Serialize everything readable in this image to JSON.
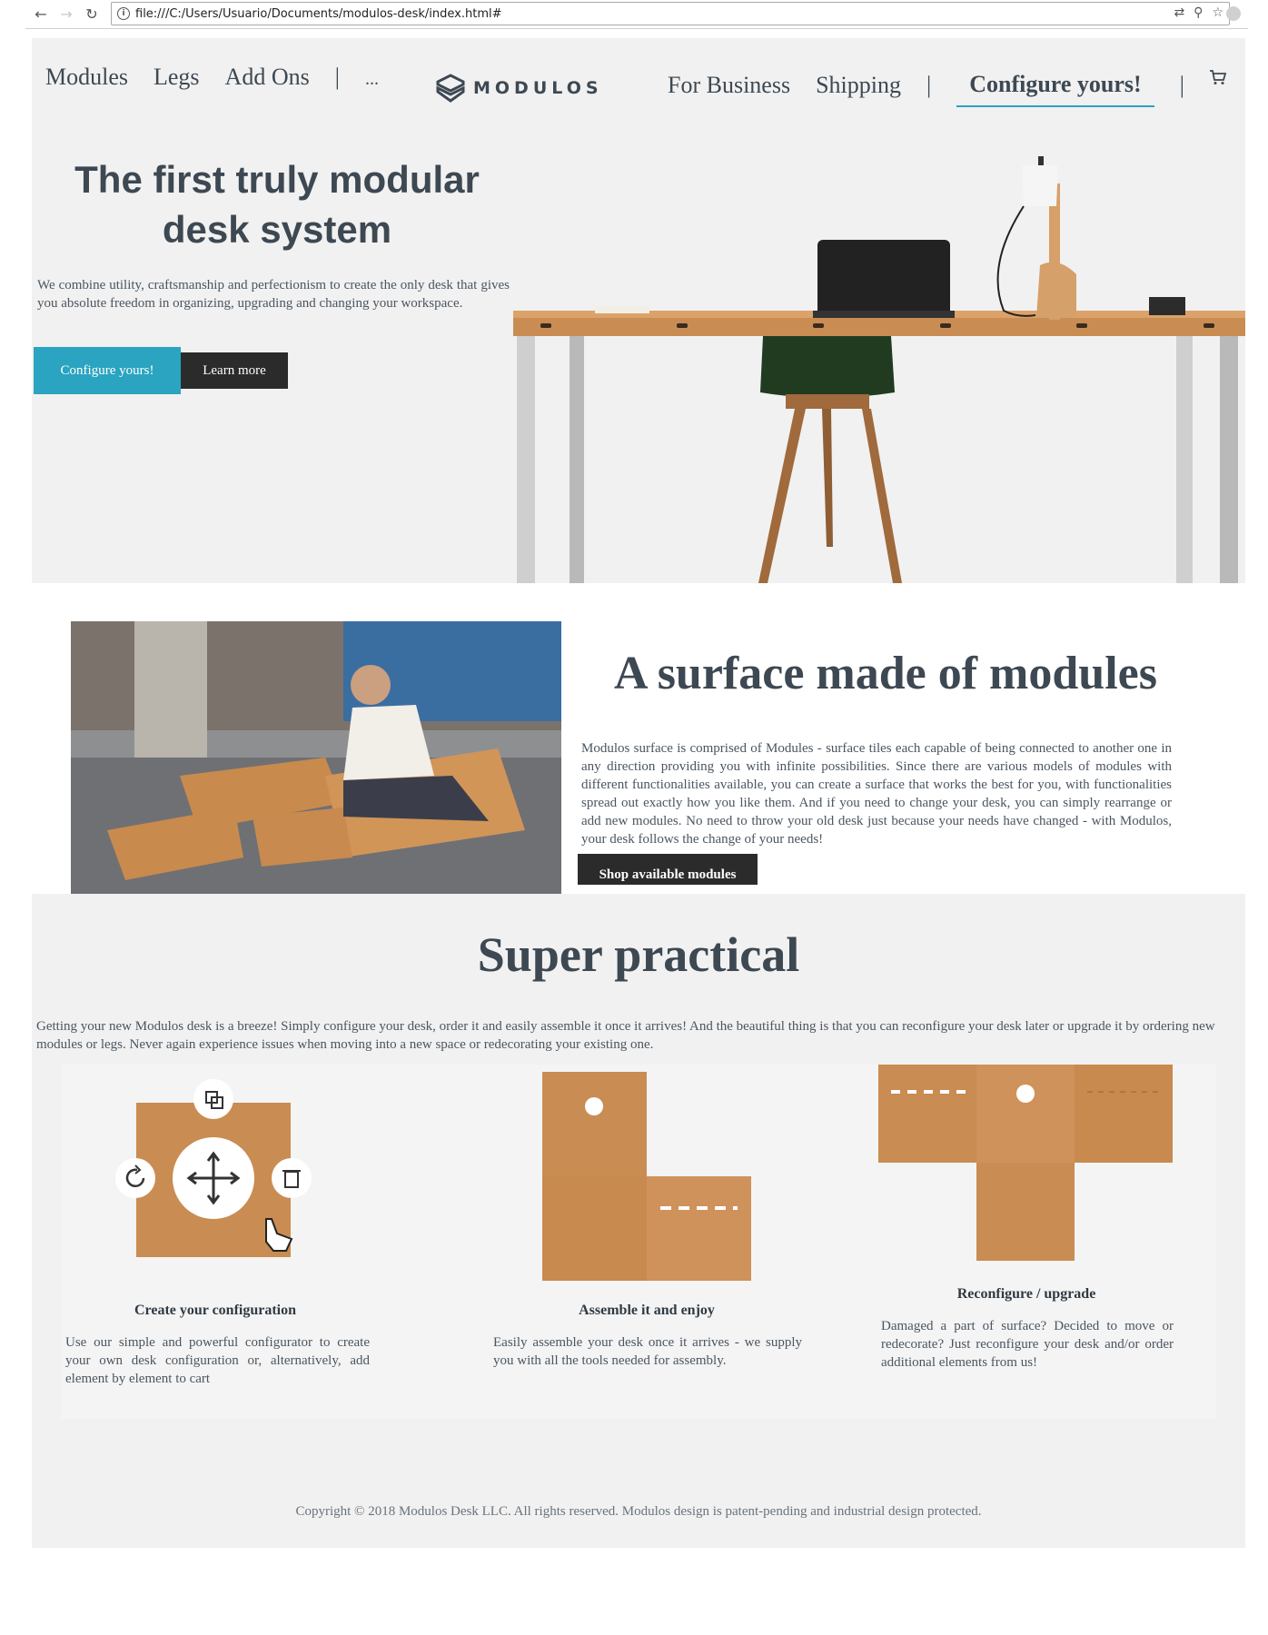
{
  "browser": {
    "url": "file:///C:/Users/Usuario/Documents/modulos-desk/index.html#"
  },
  "nav": {
    "left": [
      "Modules",
      "Legs",
      "Add Ons"
    ],
    "separator": "|",
    "more": "...",
    "logo_text": "MODULOS",
    "right": [
      "For Business",
      "Shipping"
    ],
    "configure": "Configure yours!"
  },
  "hero": {
    "title_line1": "The first truly modular",
    "title_line2": "desk system",
    "text": "We combine utility, craftsmanship and perfectionism to create the only desk that gives you absolute freedom in organizing, upgrading and changing your workspace.",
    "btn_configure": "Configure yours!",
    "btn_learn": "Learn more"
  },
  "modules": {
    "title": "A surface made of modules",
    "text": "Modulos surface is comprised of Modules - surface tiles each capable of being connected to another one in any direction providing you with infinite possibilities. Since there are various models of modules with different functionalities available, you can create a surface that works the best for you, with functionalities spread out exactly how you like them. And if you need to change your desk, you can simply rearrange or add new modules. No need to throw your old desk just because your needs have changed - with Modulos, your desk follows the change of your needs!",
    "btn": "Shop available modules"
  },
  "practical": {
    "title": "Super practical",
    "text": "Getting your new Modulos desk is a breeze! Simply configure your desk, order it and easily assemble it once it arrives! And the beautiful thing is that you can reconfigure your desk later or upgrade it by ordering new modules or legs. Never again experience issues when moving into a new space or redecorating your existing one.",
    "cols": [
      {
        "title": "Create your configuration",
        "text": "Use our simple and powerful configurator to create your own desk configuration or, alternatively, add element by element to cart"
      },
      {
        "title": "Assemble it and enjoy",
        "text": "Easily assemble your desk once it arrives - we supply you with all the tools needed for assembly."
      },
      {
        "title": "Reconfigure / upgrade",
        "text": "Damaged a part of surface? Decided to move or redecorate? Just reconfigure your desk and/or order additional elements from us!"
      }
    ]
  },
  "footer": "Copyright © 2018 Modulos Desk LLC. All rights reserved. Modulos design is patent-pending and industrial design protected.",
  "colors": {
    "accent": "#2aa4c0",
    "dark_button": "#2b2b2b",
    "text": "#3d4852",
    "section_bg": "#f1f1f1"
  }
}
